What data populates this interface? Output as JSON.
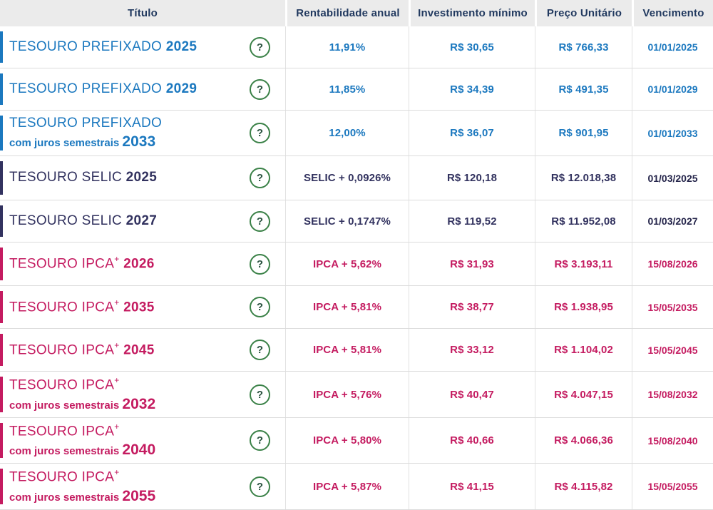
{
  "colors": {
    "prefixado_blue": "#1b78bf",
    "selic_navy": "#32325f",
    "ipca_crimson": "#c41b60",
    "header_text": "#21395f",
    "header_bg": "#ebebeb",
    "help_icon_green": "#3a8147",
    "row_border": "#dcdcdc"
  },
  "table": {
    "help_icon": "?",
    "headers": [
      "Título",
      "Rentabilidade anual",
      "Investimento mínimo",
      "Preço Unitário",
      "Vencimento"
    ],
    "rows": [
      {
        "name": "TESOURO PREFIXADO",
        "sup": "",
        "subtitle": "",
        "year": "2025",
        "theme": "blue",
        "rate": "11,91%",
        "min_investment": "R$ 30,65",
        "unit_price": "R$ 766,33",
        "maturity": "01/01/2025"
      },
      {
        "name": "TESOURO PREFIXADO",
        "sup": "",
        "subtitle": "",
        "year": "2029",
        "theme": "blue",
        "rate": "11,85%",
        "min_investment": "R$ 34,39",
        "unit_price": "R$ 491,35",
        "maturity": "01/01/2029"
      },
      {
        "name": "TESOURO PREFIXADO",
        "sup": "",
        "subtitle": "com juros semestrais",
        "year": "2033",
        "theme": "blue",
        "rate": "12,00%",
        "min_investment": "R$ 36,07",
        "unit_price": "R$ 901,95",
        "maturity": "01/01/2033"
      },
      {
        "name": "TESOURO SELIC",
        "sup": "",
        "subtitle": "",
        "year": "2025",
        "theme": "navy",
        "rate": "SELIC + 0,0926%",
        "min_investment": "R$ 120,18",
        "unit_price": "R$ 12.018,38",
        "maturity": "01/03/2025"
      },
      {
        "name": "TESOURO SELIC",
        "sup": "",
        "subtitle": "",
        "year": "2027",
        "theme": "navy",
        "rate": "SELIC + 0,1747%",
        "min_investment": "R$ 119,52",
        "unit_price": "R$ 11.952,08",
        "maturity": "01/03/2027"
      },
      {
        "name": "TESOURO IPCA",
        "sup": "+",
        "subtitle": "",
        "year": "2026",
        "theme": "crimson",
        "rate": "IPCA + 5,62%",
        "min_investment": "R$ 31,93",
        "unit_price": "R$ 3.193,11",
        "maturity": "15/08/2026"
      },
      {
        "name": "TESOURO IPCA",
        "sup": "+",
        "subtitle": "",
        "year": "2035",
        "theme": "crimson",
        "rate": "IPCA + 5,81%",
        "min_investment": "R$ 38,77",
        "unit_price": "R$ 1.938,95",
        "maturity": "15/05/2035"
      },
      {
        "name": "TESOURO IPCA",
        "sup": "+",
        "subtitle": "",
        "year": "2045",
        "theme": "crimson",
        "rate": "IPCA + 5,81%",
        "min_investment": "R$ 33,12",
        "unit_price": "R$ 1.104,02",
        "maturity": "15/05/2045"
      },
      {
        "name": "TESOURO IPCA",
        "sup": "+",
        "subtitle": "com juros semestrais",
        "year": "2032",
        "theme": "crimson",
        "rate": "IPCA + 5,76%",
        "min_investment": "R$ 40,47",
        "unit_price": "R$ 4.047,15",
        "maturity": "15/08/2032"
      },
      {
        "name": "TESOURO IPCA",
        "sup": "+",
        "subtitle": "com juros semestrais",
        "year": "2040",
        "theme": "crimson",
        "rate": "IPCA + 5,80%",
        "min_investment": "R$ 40,66",
        "unit_price": "R$ 4.066,36",
        "maturity": "15/08/2040"
      },
      {
        "name": "TESOURO IPCA",
        "sup": "+",
        "subtitle": "com juros semestrais",
        "year": "2055",
        "theme": "crimson",
        "rate": "IPCA + 5,87%",
        "min_investment": "R$ 41,15",
        "unit_price": "R$ 4.115,82",
        "maturity": "15/05/2055"
      }
    ]
  }
}
